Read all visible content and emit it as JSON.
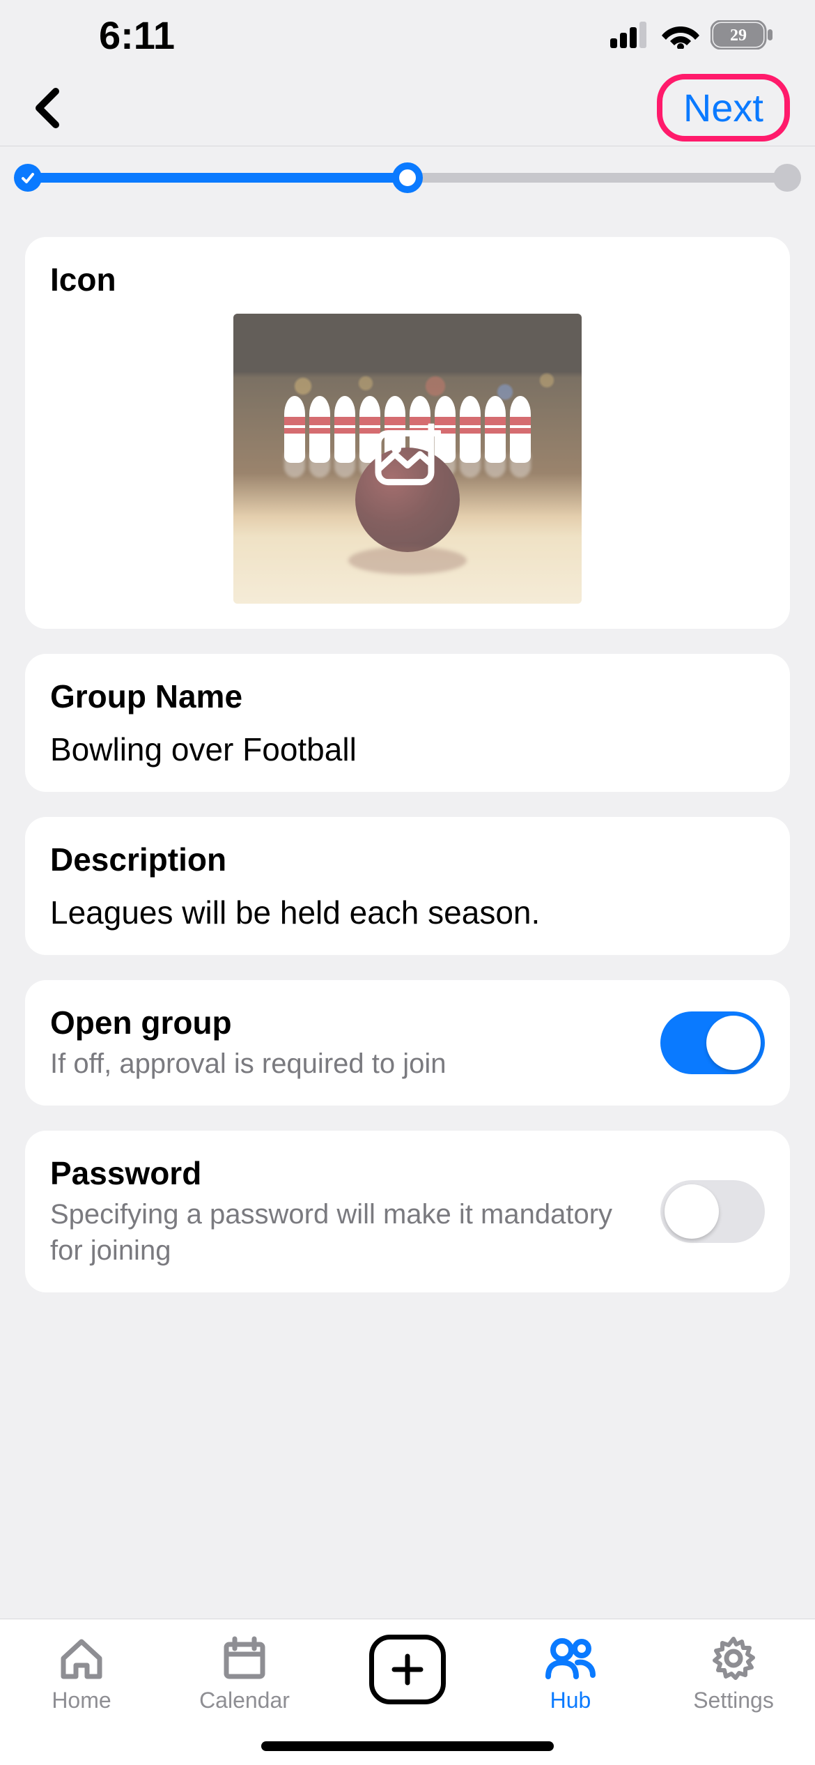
{
  "status": {
    "time": "6:11",
    "battery": "29"
  },
  "nav": {
    "next_label": "Next"
  },
  "progress": {
    "step": 2,
    "total": 3
  },
  "icon_card": {
    "label": "Icon"
  },
  "group_name_card": {
    "label": "Group Name",
    "value": "Bowling over Football"
  },
  "description_card": {
    "label": "Description",
    "value": "Leagues will be held each season."
  },
  "open_group_card": {
    "title": "Open group",
    "subtitle": "If off, approval is required to join",
    "on": true
  },
  "password_card": {
    "title": "Password",
    "subtitle": "Specifying a password will make it mandatory for joining",
    "on": false
  },
  "tabs": {
    "home": "Home",
    "calendar": "Calendar",
    "hub": "Hub",
    "settings": "Settings",
    "active": "hub"
  }
}
